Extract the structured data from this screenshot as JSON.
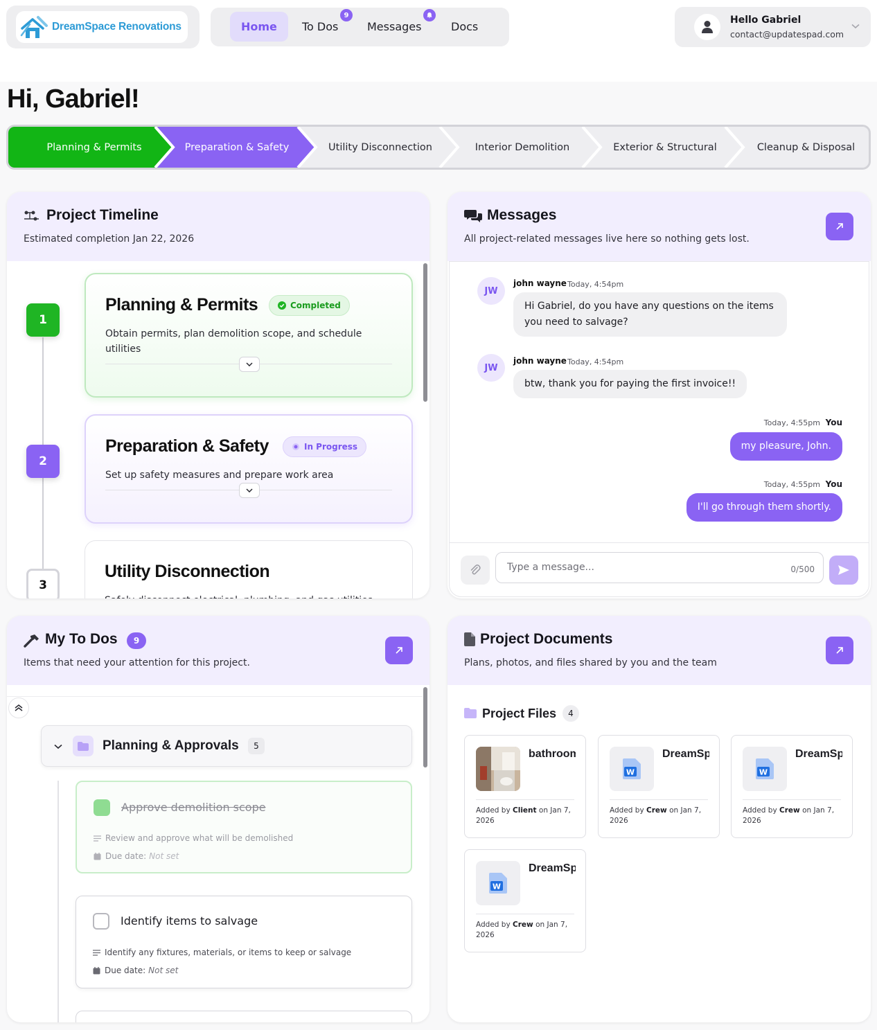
{
  "brand": {
    "name": "DreamSpace Renovations"
  },
  "nav": {
    "items": [
      {
        "label": "Home",
        "active": true
      },
      {
        "label": "To Dos",
        "badge": "9"
      },
      {
        "label": "Messages",
        "badge_icon": "bell-icon"
      },
      {
        "label": "Docs"
      }
    ]
  },
  "user": {
    "greeting": "Hello Gabriel",
    "email": "contact@updatespad.com"
  },
  "page_title": "Hi, Gabriel!",
  "stepper": {
    "steps": [
      {
        "label": "Planning & Permits",
        "state": "completed"
      },
      {
        "label": "Preparation & Safety",
        "state": "current"
      },
      {
        "label": "Utility Disconnection",
        "state": "pending"
      },
      {
        "label": "Interior Demolition",
        "state": "pending"
      },
      {
        "label": "Exterior & Structural",
        "state": "pending"
      },
      {
        "label": "Cleanup & Disposal",
        "state": "pending"
      }
    ]
  },
  "timeline": {
    "title": "Project Timeline",
    "subtitle": "Estimated completion Jan 22, 2026",
    "phases": [
      {
        "num": "1",
        "title": "Planning & Permits",
        "status": "Completed",
        "desc": "Obtain permits, plan demolition scope, and schedule utilities"
      },
      {
        "num": "2",
        "title": "Preparation & Safety",
        "status": "In Progress",
        "desc": "Set up safety measures and prepare work area"
      },
      {
        "num": "3",
        "title": "Utility Disconnection",
        "desc": "Safely disconnect electrical, plumbing, and gas utilities"
      }
    ]
  },
  "messages": {
    "title": "Messages",
    "subtitle": "All project-related messages live here so nothing gets lost.",
    "list": [
      {
        "initials": "JW",
        "name": "john wayne",
        "time": "Today, 4:54pm",
        "text": "Hi Gabriel, do you have any questions on the items you need to salvage?"
      },
      {
        "initials": "JW",
        "name": "john wayne",
        "time": "Today, 4:54pm",
        "text": "btw, thank you for paying the first invoice!!"
      },
      {
        "name": "You",
        "time": "Today, 4:55pm",
        "text": "my pleasure, John."
      },
      {
        "name": "You",
        "time": "Today, 4:55pm",
        "text": "I'll go through them shortly."
      }
    ],
    "input_placeholder": "Type a message...",
    "char_count": "0/500"
  },
  "todos": {
    "title": "My To Dos",
    "count": "9",
    "subtitle": "Items that need your attention for this project.",
    "group": {
      "title": "Planning & Approvals",
      "count": "5"
    },
    "items": [
      {
        "title": "Approve demolition scope",
        "desc": "Review and approve what will be demolished",
        "due_label": "Due date:",
        "due": "Not set",
        "done": true
      },
      {
        "title": "Identify items to salvage",
        "desc": "Identify any fixtures, materials, or items to keep or salvage",
        "due_label": "Due date:",
        "due": "Not set",
        "done": false
      }
    ]
  },
  "documents": {
    "title": "Project Documents",
    "subtitle": "Plans, photos, and files shared by you and the team",
    "folder": {
      "title": "Project Files",
      "count": "4"
    },
    "files": [
      {
        "name": "bathroom",
        "added_prefix": "Added by",
        "by": "Client",
        "date": "on Jan 7, 2026",
        "type": "photo"
      },
      {
        "name": "DreamSpace",
        "added_prefix": "Added by",
        "by": "Crew",
        "date": "on Jan 7, 2026",
        "type": "word"
      },
      {
        "name": "DreamSpace",
        "added_prefix": "Added by",
        "by": "Crew",
        "date": "on Jan 7, 2026",
        "type": "word"
      },
      {
        "name": "DreamSpace",
        "added_prefix": "Added by",
        "by": "Crew",
        "date": "on Jan 7, 2026",
        "type": "word"
      }
    ]
  },
  "colors": {
    "accent": "#8a63f3",
    "success": "#1fb524",
    "accent_light": "#f2eefe"
  }
}
